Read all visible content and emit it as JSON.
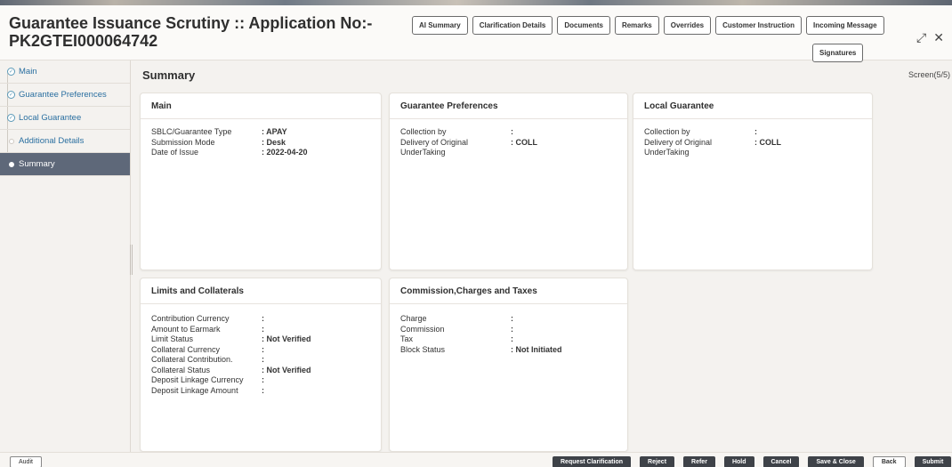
{
  "header": {
    "title_line1": "Guarantee Issuance Scrutiny :: Application No:-",
    "title_line2": "PK2GTEI000064742",
    "buttons": [
      "AI Summary",
      "Clarification Details",
      "Documents",
      "Remarks",
      "Overrides",
      "Customer Instruction",
      "Incoming Message"
    ],
    "signatures": "Signatures",
    "restore_icon": "⤢",
    "close_icon": "✕"
  },
  "sidebar": {
    "items": [
      {
        "label": "Main",
        "state": "done"
      },
      {
        "label": "Guarantee Preferences",
        "state": "done"
      },
      {
        "label": "Local Guarantee",
        "state": "done"
      },
      {
        "label": "Additional Details",
        "state": "pending"
      },
      {
        "label": "Summary",
        "state": "active"
      }
    ]
  },
  "main": {
    "title": "Summary",
    "screen": "Screen(5/5)",
    "cards": {
      "main": {
        "title": "Main",
        "rows": [
          {
            "label": "SBLC/Guarantee Type",
            "value": ": APAY"
          },
          {
            "label": "Submission Mode",
            "value": ": Desk"
          },
          {
            "label": "Date of Issue",
            "value": ": 2022-04-20"
          }
        ]
      },
      "guarantee_prefs": {
        "title": "Guarantee Preferences",
        "rows": [
          {
            "label": "Collection by",
            "value": ":"
          },
          {
            "label": "Delivery of Original",
            "value": ": COLL"
          },
          {
            "label": "UnderTaking",
            "value": ""
          }
        ]
      },
      "local_guarantee": {
        "title": "Local Guarantee",
        "rows": [
          {
            "label": "Collection by",
            "value": ":"
          },
          {
            "label": "Delivery of Original",
            "value": ": COLL"
          },
          {
            "label": "UnderTaking",
            "value": ""
          }
        ]
      },
      "limits": {
        "title": "Limits and Collaterals",
        "rows": [
          {
            "label": "Contribution Currency",
            "value": ":"
          },
          {
            "label": "Amount to Earmark",
            "value": ":"
          },
          {
            "label": "Limit Status",
            "value": ": Not Verified"
          },
          {
            "label": "Collateral Currency",
            "value": ":"
          },
          {
            "label": "Collateral Contribution.",
            "value": ":"
          },
          {
            "label": "Collateral Status",
            "value": ": Not Verified"
          },
          {
            "label": "Deposit Linkage Currency",
            "value": ":"
          },
          {
            "label": "Deposit Linkage Amount",
            "value": ":"
          }
        ]
      },
      "commission": {
        "title": "Commission,Charges and Taxes",
        "rows": [
          {
            "label": "Charge",
            "value": ":"
          },
          {
            "label": "Commission",
            "value": ":"
          },
          {
            "label": "Tax",
            "value": ":"
          },
          {
            "label": "Block Status",
            "value": ": Not Initiated"
          }
        ]
      }
    }
  },
  "footer": {
    "audit": "Audit",
    "actions": [
      "Request Clarification",
      "Reject",
      "Refer",
      "Hold",
      "Cancel",
      "Save & Close"
    ],
    "back": "Back",
    "submit": "Submit"
  }
}
